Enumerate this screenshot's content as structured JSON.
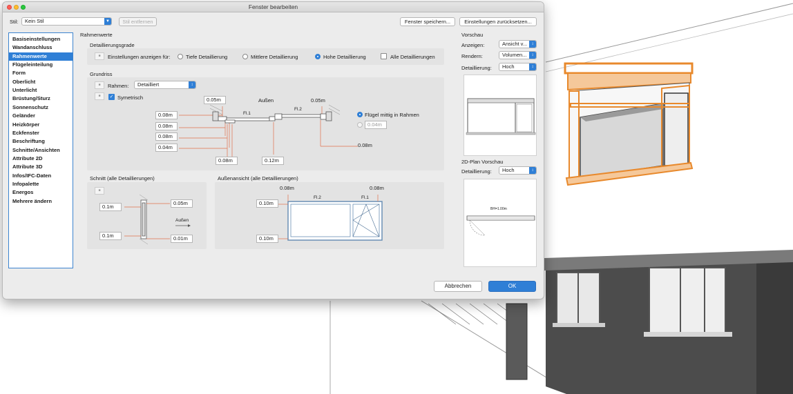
{
  "window": {
    "title": "Fenster bearbeiten"
  },
  "toolbar": {
    "stil_label": "Stil:",
    "stil_value": "Kein Stil",
    "stil_entfernen": "Stil entfernen",
    "fenster_speichern": "Fenster speichern...",
    "einstellungen_zuruecksetzen": "Einstellungen zurücksetzen..."
  },
  "sidebar": {
    "items": [
      "Basiseinstellungen",
      "Wandanschluss",
      "Rahmenwerte",
      "Flügeleinteilung",
      "Form",
      "Oberlicht",
      "Unterlicht",
      "Brüstung/Sturz",
      "Sonnenschutz",
      "Geländer",
      "Heizkörper",
      "Eckfenster",
      "Beschriftung",
      "Schnitte/Ansichten",
      "Attribute 2D",
      "Attribute 3D",
      "Infos/IFC-Daten",
      "Infopalette",
      "Energos",
      "Mehrere ändern"
    ],
    "selected_index": 2
  },
  "main": {
    "section_title": "Rahmenwerte",
    "detail": {
      "title": "Detaillierungsgrade",
      "label": "Einstellungen anzeigen für:",
      "options": [
        "Tiefe Detaillierung",
        "Mittlere Detaillierung",
        "Hohe Detaillierung"
      ],
      "selected": "Hohe Detaillierung",
      "all_label": "Alle Detaillierungen"
    },
    "grundriss": {
      "title": "Grundriss",
      "rahmen_label": "Rahmen:",
      "rahmen_value": "Detailliert",
      "symetrisch_label": "Symetrisch",
      "aussen_label": "Außen",
      "fl1": "Fl.1",
      "fl2": "Fl.2",
      "top_left": "0.05m",
      "top_right": "0.05m",
      "left_values": [
        "0.08m",
        "0.08m",
        "0.08m",
        "0.04m"
      ],
      "bottom_left": "0.08m",
      "bottom_mid": "0.12m",
      "right_value": "0.08m",
      "fluegel_label": "Flügel mittig in Rahmen",
      "fluegel_value": "0.04m"
    },
    "schnitt": {
      "title": "Schnitt (alle Detaillierungen)",
      "left_top": "0.1m",
      "left_bottom": "0.1m",
      "right_top": "0.05m",
      "right_bottom": "0.01m",
      "aussen": "Außen"
    },
    "ansicht": {
      "title": "Außenansicht (alle Detaillierungen)",
      "top_left": "0.08m",
      "top_right": "0.08m",
      "left_top": "0.10m",
      "left_bottom": "0.10m",
      "fl1": "Fl.1",
      "fl2": "Fl.2"
    }
  },
  "preview": {
    "title": "Vorschau",
    "anzeigen_label": "Anzeigen:",
    "anzeigen_value": "Ansicht v...",
    "rendern_label": "Rendern:",
    "rendern_value": "Volumen...",
    "detail_label": "Detaillierung:",
    "detail_value": "Hoch",
    "plan_title": "2D-Plan Vorschau",
    "plan_detail_label": "Detaillierung:",
    "plan_detail_value": "Hoch",
    "plan_annotation": "BH=1.00m"
  },
  "footer": {
    "abbrechen": "Abbrechen",
    "ok": "OK"
  },
  "colors": {
    "accent": "#2f7fd6",
    "dimension": "#e0704a",
    "highlight": "#e8892c"
  }
}
